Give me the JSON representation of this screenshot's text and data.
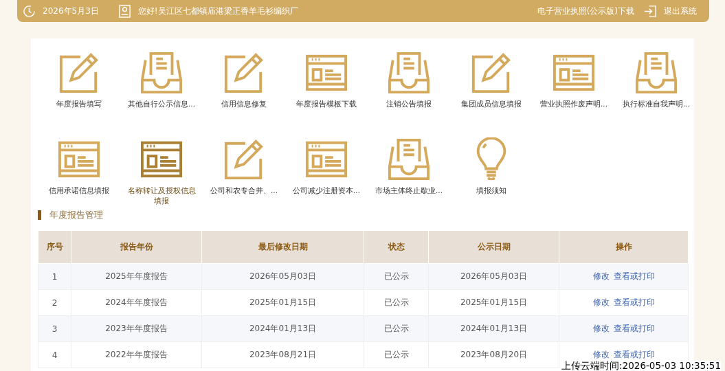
{
  "header": {
    "date": "2026年5月3日",
    "greeting": "您好!吴江区七都镇庙港梁正香羊毛衫编织厂",
    "license_link": "电子营业执照(公示版)下载",
    "logout": "退出系统"
  },
  "tiles": [
    {
      "label": "年度报告填写",
      "kind": "pencil",
      "selected": false
    },
    {
      "label": "其他自行公示信息...",
      "kind": "tray",
      "selected": false
    },
    {
      "label": "信用信息修复",
      "kind": "pencil",
      "selected": false
    },
    {
      "label": "年度报告模板下载",
      "kind": "window",
      "selected": false
    },
    {
      "label": "注销公告填报",
      "kind": "tray",
      "selected": false
    },
    {
      "label": "集团成员信息填报",
      "kind": "pencil",
      "selected": false
    },
    {
      "label": "营业执照作废声明...",
      "kind": "window",
      "selected": false
    },
    {
      "label": "执行标准自我声明...",
      "kind": "tray",
      "selected": false
    },
    {
      "label": "信用承诺信息填报",
      "kind": "window",
      "selected": false
    },
    {
      "label": "名称转让及授权信息填报",
      "kind": "window",
      "selected": true
    },
    {
      "label": "公司和农专合并、...",
      "kind": "pencil",
      "selected": false
    },
    {
      "label": "公司减少注册资本...",
      "kind": "window",
      "selected": false
    },
    {
      "label": "市场主体终止歇业...",
      "kind": "tray",
      "selected": false
    },
    {
      "label": "填报须知",
      "kind": "bulb",
      "selected": false
    }
  ],
  "section_title": "年度报告管理",
  "table": {
    "columns": [
      "序号",
      "报告年份",
      "最后修改日期",
      "状态",
      "公示日期",
      "操作"
    ],
    "rows": [
      {
        "cells": [
          "1",
          "2025年年度报告",
          "2026年05月03日",
          "已公示",
          "2026年05月03日"
        ],
        "actions": [
          "修改",
          "查看或打印"
        ]
      },
      {
        "cells": [
          "2",
          "2024年年度报告",
          "2025年01月15日",
          "已公示",
          "2025年01月15日"
        ],
        "actions": [
          "修改",
          "查看或打印"
        ]
      },
      {
        "cells": [
          "3",
          "2023年年度报告",
          "2024年01月13日",
          "已公示",
          "2024年01月13日"
        ],
        "actions": [
          "修改",
          "查看或打印"
        ]
      },
      {
        "cells": [
          "4",
          "2022年年度报告",
          "2023年08月21日",
          "已公示",
          "2023年08月20日"
        ],
        "actions": [
          "修改",
          "查看或打印"
        ]
      }
    ]
  },
  "upload_time": "上传云端时间:2026-05-03 10:35:51"
}
